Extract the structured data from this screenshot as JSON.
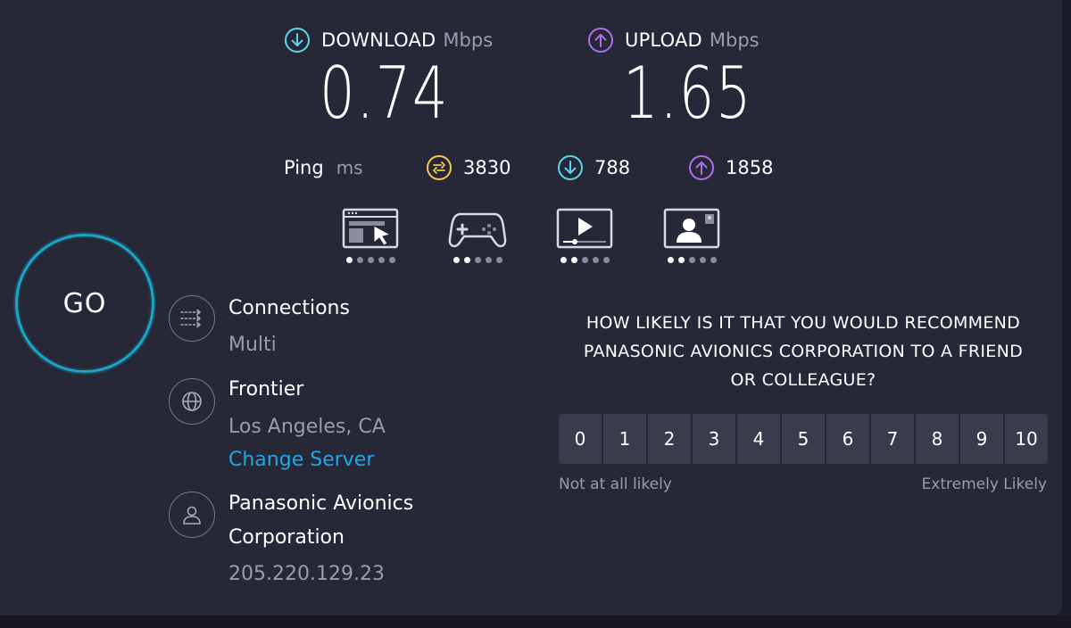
{
  "download": {
    "label": "DOWNLOAD",
    "unit": "Mbps",
    "value": "0.74",
    "icon": "arrow-down-circle-icon",
    "color": "#5fd6e8"
  },
  "upload": {
    "label": "UPLOAD",
    "unit": "Mbps",
    "value": "1.65",
    "icon": "arrow-up-circle-icon",
    "color": "#b06ee8"
  },
  "ping": {
    "label": "Ping",
    "unit": "ms",
    "idle": {
      "value": "3830",
      "icon": "jitter-icon",
      "color": "#f3c94b"
    },
    "down": {
      "value": "788",
      "icon": "arrow-down-circle-icon",
      "color": "#5fd6e8"
    },
    "up": {
      "value": "1858",
      "icon": "arrow-up-circle-icon",
      "color": "#b06ee8"
    }
  },
  "ratings": [
    {
      "name": "web-browsing",
      "icon": "browser-cursor-icon",
      "level": 1,
      "max": 5
    },
    {
      "name": "gaming",
      "icon": "gamepad-icon",
      "level": 2,
      "max": 5
    },
    {
      "name": "video-streaming",
      "icon": "video-player-icon",
      "level": 2,
      "max": 5
    },
    {
      "name": "video-chat",
      "icon": "video-call-icon",
      "level": 2,
      "max": 5
    }
  ],
  "go_button": {
    "label": "GO"
  },
  "connections": {
    "title": "Connections",
    "value": "Multi",
    "icon": "connections-icon"
  },
  "server": {
    "title": "Frontier",
    "location": "Los Angeles, CA",
    "change_label": "Change Server",
    "icon": "globe-icon"
  },
  "provider": {
    "title_line1": "Panasonic Avionics",
    "title_line2": "Corporation",
    "ip": "205.220.129.23",
    "icon": "user-icon"
  },
  "survey": {
    "question_line1": "HOW LIKELY IS IT THAT YOU WOULD RECOMMEND",
    "question_line2": "PANASONIC AVIONICS CORPORATION TO A FRIEND",
    "question_line3": "OR COLLEAGUE?",
    "scale": [
      "0",
      "1",
      "2",
      "3",
      "4",
      "5",
      "6",
      "7",
      "8",
      "9",
      "10"
    ],
    "low_label": "Not at all likely",
    "high_label": "Extremely Likely"
  },
  "colors": {
    "background": "#262838",
    "accent": "#1aa6c8",
    "link": "#1fa7e8",
    "muted": "#9a9bb0"
  }
}
